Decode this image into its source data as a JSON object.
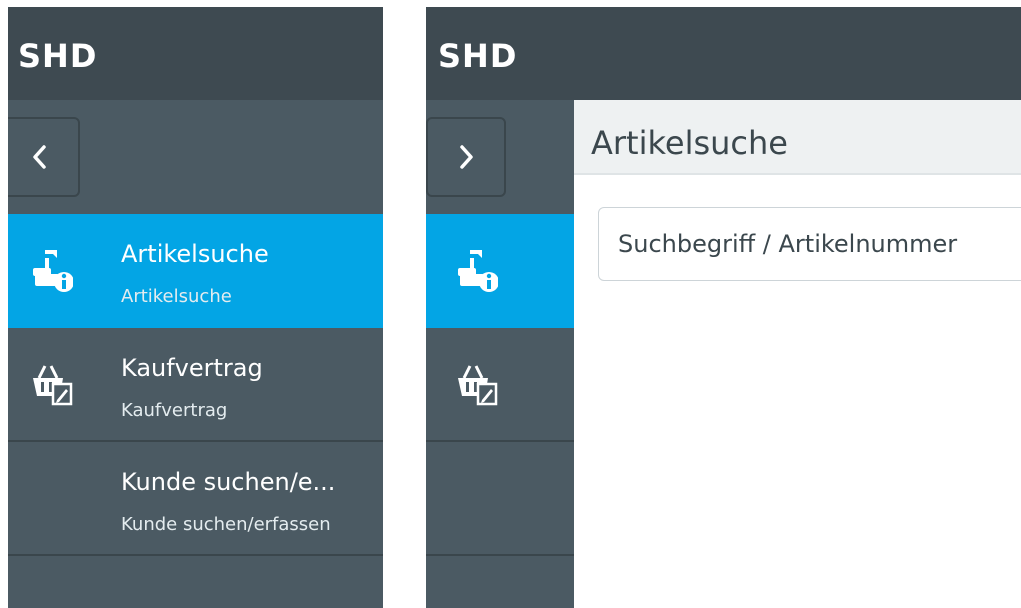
{
  "left_view": {
    "brand": "SHD",
    "toggle_label": "‹",
    "nav_items": [
      {
        "title": "Artikelsuche",
        "subtitle": "Artikelsuche",
        "icon": "product-info-icon",
        "active": true
      },
      {
        "title": "Kaufvertrag",
        "subtitle": "Kaufvertrag",
        "icon": "basket-contract-icon",
        "active": false
      },
      {
        "title": "Kunde suchen/e...",
        "subtitle": "Kunde suchen/erfassen",
        "icon": "",
        "active": false
      }
    ]
  },
  "right_view": {
    "brand": "SHD",
    "toggle_label": "›",
    "page_title": "Artikelsuche",
    "search": {
      "placeholder": "Suchbegriff / Artikelnummer",
      "value": ""
    }
  },
  "colors": {
    "topbar": "#3e4a51",
    "sidebar": "#4b5a63",
    "accent": "#03a5e5",
    "header_bg": "#eef1f2",
    "text_dark": "#3b474d"
  }
}
